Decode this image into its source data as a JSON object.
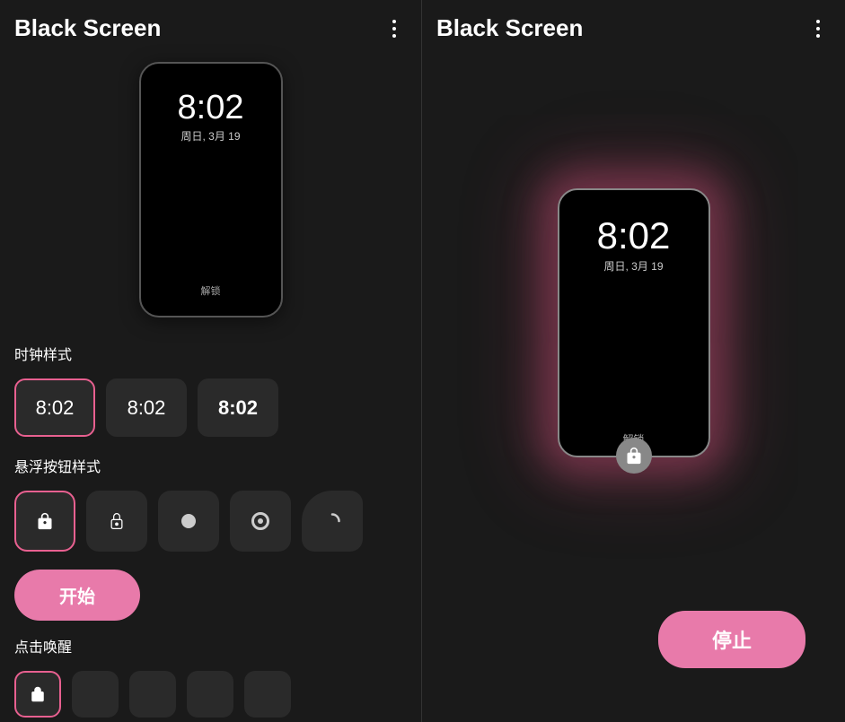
{
  "left_panel": {
    "title": "Black Screen",
    "menu_label": "⋮",
    "phone": {
      "time": "8:02",
      "date": "周日, 3月 19",
      "unlock": "解锁"
    },
    "clock_style_label": "时钟样式",
    "clock_options": [
      {
        "id": "thin",
        "text": "8:02",
        "weight": "thin",
        "selected": true
      },
      {
        "id": "normal",
        "text": "8:02",
        "weight": "normal",
        "selected": false
      },
      {
        "id": "bold",
        "text": "8:02",
        "weight": "bold",
        "selected": false
      }
    ],
    "float_button_label": "悬浮按钮样式",
    "float_buttons": [
      {
        "id": "lock-fill",
        "selected": true
      },
      {
        "id": "lock-outline",
        "selected": false
      },
      {
        "id": "circle-fill",
        "selected": false
      },
      {
        "id": "circle-ring",
        "selected": false
      },
      {
        "id": "partial-circle",
        "selected": false
      }
    ],
    "start_button_label": "开始",
    "wake_tap_label": "点击唤醒",
    "wake_options": [
      {
        "id": "opt1",
        "selected": true
      },
      {
        "id": "opt2",
        "selected": false
      },
      {
        "id": "opt3",
        "selected": false
      },
      {
        "id": "opt4",
        "selected": false
      },
      {
        "id": "opt5",
        "selected": false
      }
    ]
  },
  "right_panel": {
    "title": "Black Screen",
    "menu_label": "⋮",
    "phone": {
      "time": "8:02",
      "date": "周日, 3月 19",
      "unlock": "解锁"
    },
    "stop_button_label": "停止"
  }
}
